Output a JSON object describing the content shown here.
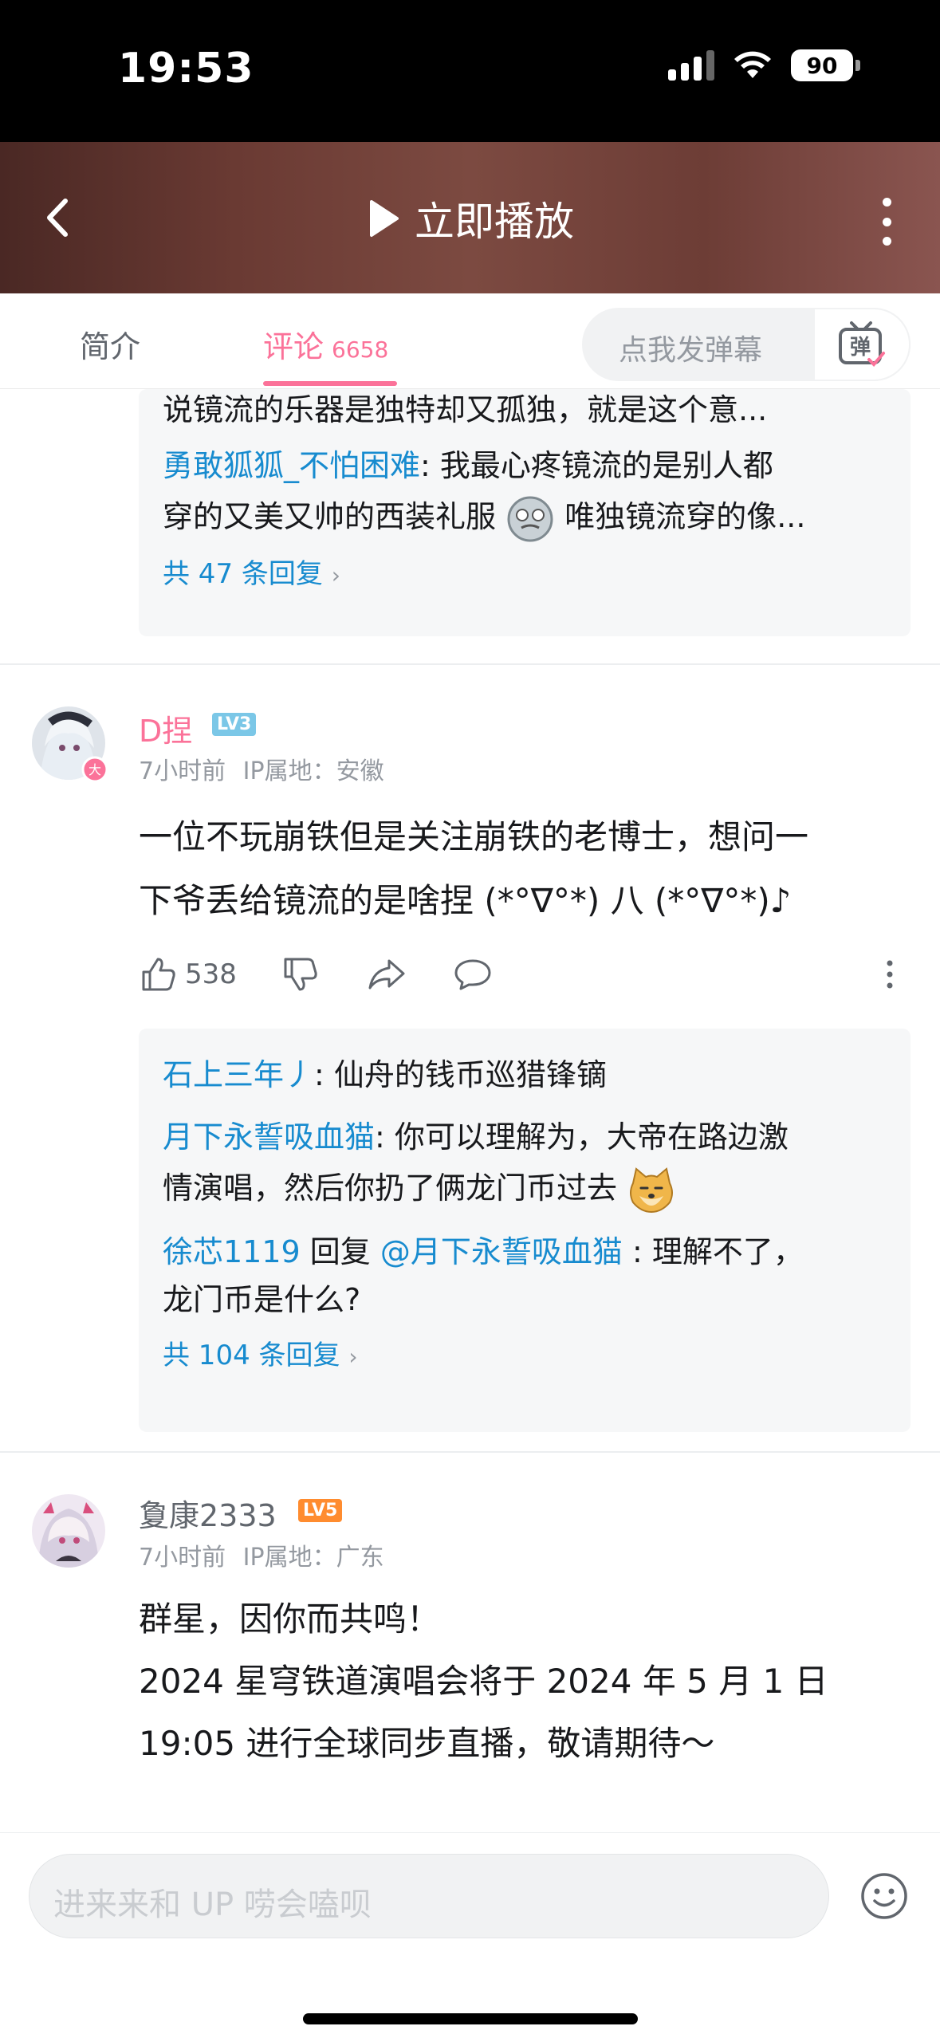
{
  "status": {
    "time": "19:53",
    "battery": "90"
  },
  "header": {
    "play_label": "立即播放"
  },
  "tabs": {
    "intro_label": "简介",
    "comments_label": "评论",
    "comments_count": "6658",
    "danmaku_placeholder": "点我发弹幕",
    "danmaku_toggle": "弹"
  },
  "prev_thread": {
    "cut_line": "说镜流的乐器是独特却又孤独，就是这个意...",
    "reply_user": "勇敢狐狐_不怕困难",
    "reply_text_1": ": 我最心疼镜流的是别人都",
    "reply_text_2a": "穿的又美又帅的西装礼服",
    "reply_text_2b": "唯独镜流穿的像...",
    "more_label": "共 47 条回复"
  },
  "comments": [
    {
      "username": "D捏",
      "level": "LV3",
      "avatar_badge": "大",
      "time": "7小时前",
      "ip": "IP属地：安徽",
      "text_1": "一位不玩崩铁但是关注崩铁的老博士，想问一",
      "text_2": "下爷丢给镜流的是啥捏 (*°∇°*) 八 (*°∇°*)♪",
      "likes": "538",
      "replies": [
        {
          "user": "石上三年丿",
          "text": ": 仙舟的钱币巡猎锋镝"
        },
        {
          "user": "月下永誓吸血猫",
          "text": ": 你可以理解为，大帝在路边激",
          "text_cont": "情演唱，然后你扔了俩龙门币过去"
        },
        {
          "user": "徐芯1119",
          "connector": " 回复 ",
          "target": "@月下永誓吸血猫",
          "text": " : 理解不了，",
          "text_cont": "龙门币是什么?"
        }
      ],
      "more_label": "共 104 条回复"
    },
    {
      "username": "夐康2333",
      "level": "LV5",
      "time": "7小时前",
      "ip": "IP属地：广东",
      "text_1": "群星，因你而共鸣！",
      "text_2": "2024 星穹铁道演唱会将于 2024 年 5 月 1 日",
      "text_3": "19:05 进行全球同步直播，敬请期待～"
    }
  ],
  "bottom": {
    "input_placeholder": "进来来和 UP 唠会嗑呗"
  },
  "colors": {
    "accent": "#fb7299",
    "link": "#178bcf",
    "lv3": "#7bc7e7",
    "lv5": "#ff8c2f"
  }
}
